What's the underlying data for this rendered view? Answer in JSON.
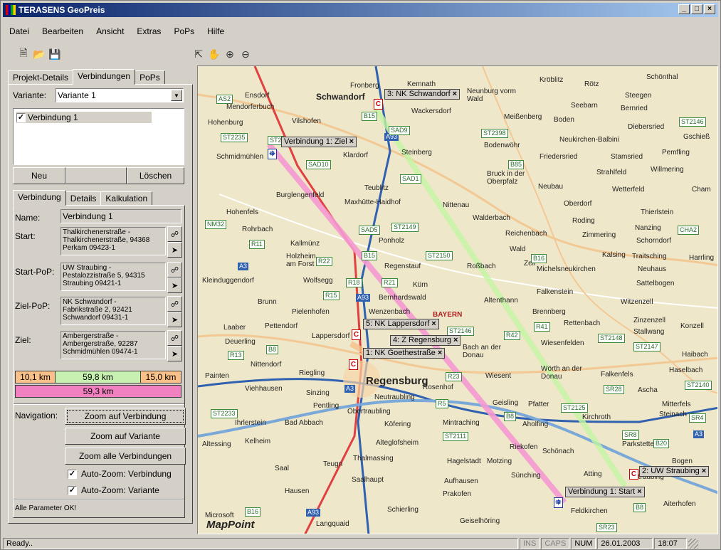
{
  "window": {
    "title": "TERASENS GeoPreis",
    "min": "_",
    "max": "□",
    "close": "×"
  },
  "menu": [
    "Datei",
    "Bearbeiten",
    "Ansicht",
    "Extras",
    "PoPs",
    "Hilfe"
  ],
  "toolbar": {
    "icons": [
      "new-file-icon",
      "open-folder-icon",
      "save-icon",
      "select-arrow-icon",
      "pan-hand-icon",
      "zoom-in-icon",
      "zoom-out-icon"
    ]
  },
  "tabs_top": [
    "Projekt-Details",
    "Verbindungen",
    "PoPs"
  ],
  "variante": {
    "label": "Variante:",
    "value": "Variante 1"
  },
  "list": {
    "item": "Verbindung 1"
  },
  "buttons": {
    "neu": "Neu",
    "loeschen": "Löschen"
  },
  "tabs_sub": [
    "Verbindung",
    "Details",
    "Kalkulation"
  ],
  "fields": {
    "name": {
      "label": "Name:",
      "value": "Verbindung 1"
    },
    "start": {
      "label": "Start:",
      "lines": [
        "Thalkirchenerstraße -",
        "Thalkirchenerstraße, 94368",
        "Perkam  09423-1"
      ]
    },
    "startpop": {
      "label": "Start-PoP:",
      "lines": [
        "UW Straubing -",
        "Pestalozzistraße 5, 94315",
        "Straubing  09421-1"
      ]
    },
    "zielpop": {
      "label": "Ziel-PoP:",
      "lines": [
        "NK Schwandorf -",
        "Fabrikstraße 2, 92421",
        "Schwandorf  09431-1"
      ]
    },
    "ziel": {
      "label": "Ziel:",
      "lines": [
        "Ambergerstraße -",
        "Ambergerstraße, 92287",
        "Schmidmühlen  09474-1"
      ]
    }
  },
  "distances": {
    "d1": "10,1 km",
    "d2": "59,8 km",
    "d3": "15,0 km",
    "total": "59,3 km",
    "c1": "#f9c089",
    "c2": "#c8f0b0",
    "c3": "#f9c089",
    "ct": "#f080c0"
  },
  "navigation": {
    "label": "Navigation:",
    "b1": "Zoom auf Verbindung",
    "b2": "Zoom auf Variante",
    "b3": "Zoom alle Verbindungen",
    "c1": "Auto-Zoom: Verbindung",
    "c2": "Auto-Zoom: Variante"
  },
  "params_status": "Alle Parameter OK!",
  "map": {
    "markers": {
      "m3": "3: NK Schwandorf",
      "vz": "Verbindung 1: Ziel",
      "m5": "5: NK Lappersdorf",
      "m4": "4: Z Regensburg",
      "m1": "1: NK Goethestraße",
      "m2": "2: UW Straubing",
      "vs": "Verbindung 1: Start",
      "x": "×",
      "ziel_sym": "⛯",
      "pop_sym": "C",
      "start_sym": "⛯"
    },
    "towns": [
      "Kröblitz",
      "Rötz",
      "Schönthal",
      "Fronberg",
      "Kemnath",
      "Schwandorf",
      "Neunburg vorm Wald",
      "Steegen",
      "Ensdorf",
      "Mendorferbuch",
      "Wackersdorf",
      "Seebarn",
      "Bernried",
      "Hohenburg",
      "Vilshofen",
      "Meißenberg",
      "Boden",
      "Diebersried",
      "Gschieß",
      "Schmidmühlen",
      "Klardorf",
      "Bodenwöhr",
      "Neukirchen-Balbini",
      "Steinberg",
      "Friedersried",
      "Stamsried",
      "Pemfling",
      "Bruck in der Oberpfalz",
      "Strahlfeld",
      "Willmering",
      "Teublitz",
      "Neubau",
      "Wetterfeld",
      "Cham",
      "Burglengenfeld",
      "Maxhütte-Haidhof",
      "Nittenau",
      "Oberdorf",
      "Hohenfels",
      "Walderbach",
      "Roding",
      "Thierlstein",
      "Rohrbach",
      "Ponholz",
      "Reichenbach",
      "Nanzing",
      "Zimmering",
      "Schorndorf",
      "Kallmünz",
      "Wald",
      "Kalsing",
      "Traitsching",
      "Harrling",
      "Holzheim am Forst",
      "Regenstauf",
      "Roßbach",
      "Zell",
      "Michelsneukirchen",
      "Neuhaus",
      "Kleinduggendorf",
      "Wolfsegg",
      "Kürn",
      "Sattelbogen",
      "Falkenstein",
      "Brunn",
      "Bernhardswald",
      "Altenthann",
      "Witzenzell",
      "Pielenhofen",
      "Wenzenbach",
      "BAYERN",
      "Brennberg",
      "Zinzenzell",
      "Laaber",
      "Pettendorf",
      "Lappersdorf",
      "Rettenbach",
      "Stallwang",
      "Konzell",
      "Deuerling",
      "Bach an der Donau",
      "Wiesenfelden",
      "Nittendorf",
      "Riegling",
      "Wörth an der Donau",
      "Falkenfels",
      "Haibach",
      "Haselbach",
      "Painten",
      "Regensburg",
      "Wiesent",
      "Ascha",
      "Viehhausen",
      "Sinzing",
      "Neutraubling",
      "Rosenhof",
      "Geisling",
      "Pfatter",
      "Mitterfels",
      "Pentling",
      "Steinach",
      "Obertraubling",
      "Köfering",
      "Mintraching",
      "Aholfing",
      "Kirchroth",
      "Ihrlerstein",
      "Bad Abbach",
      "Parkstetten",
      "Altessing",
      "Kelheim",
      "Alteglofsheim",
      "Riekofen",
      "Schönach",
      "Teugn",
      "Thalmassing",
      "Hagelstadt",
      "Motzing",
      "Saal",
      "Bogen",
      "Sünching",
      "Atting",
      "Saalhaupt",
      "Aufhausen",
      "Hausen",
      "Prakofen",
      "Straubing",
      "Aiterhofen",
      "Feldkirchen",
      "Schierling",
      "Langquaid",
      "Geiselhöring",
      "Microsoft",
      "MapPoint"
    ],
    "roads": [
      "AS2",
      "B15",
      "A93",
      "ST2235",
      "SAD9",
      "ST2398",
      "ST2146",
      "ST2",
      "SAD10",
      "B85",
      "SAD1",
      "NM32",
      "SAD5",
      "ST2149",
      "R11",
      "B15",
      "ST2150",
      "B16",
      "R22",
      "R18",
      "R21",
      "R15",
      "A93",
      "A3",
      "R41",
      "R42",
      "ST2146",
      "R13",
      "B8",
      "ST2148",
      "ST2147",
      "R23",
      "A3",
      "SR28",
      "ST2140",
      "R5",
      "B8",
      "ST2125",
      "ST2233",
      "SR4",
      "ST2111",
      "SR8",
      "B20",
      "A3",
      "B16",
      "A93",
      "B8",
      "SR23",
      "CHA2"
    ]
  },
  "statusbar": {
    "text": "Ready..",
    "ins": "INS",
    "caps": "CAPS",
    "num": "NUM",
    "date": "26.01.2003",
    "time": "18:07"
  }
}
